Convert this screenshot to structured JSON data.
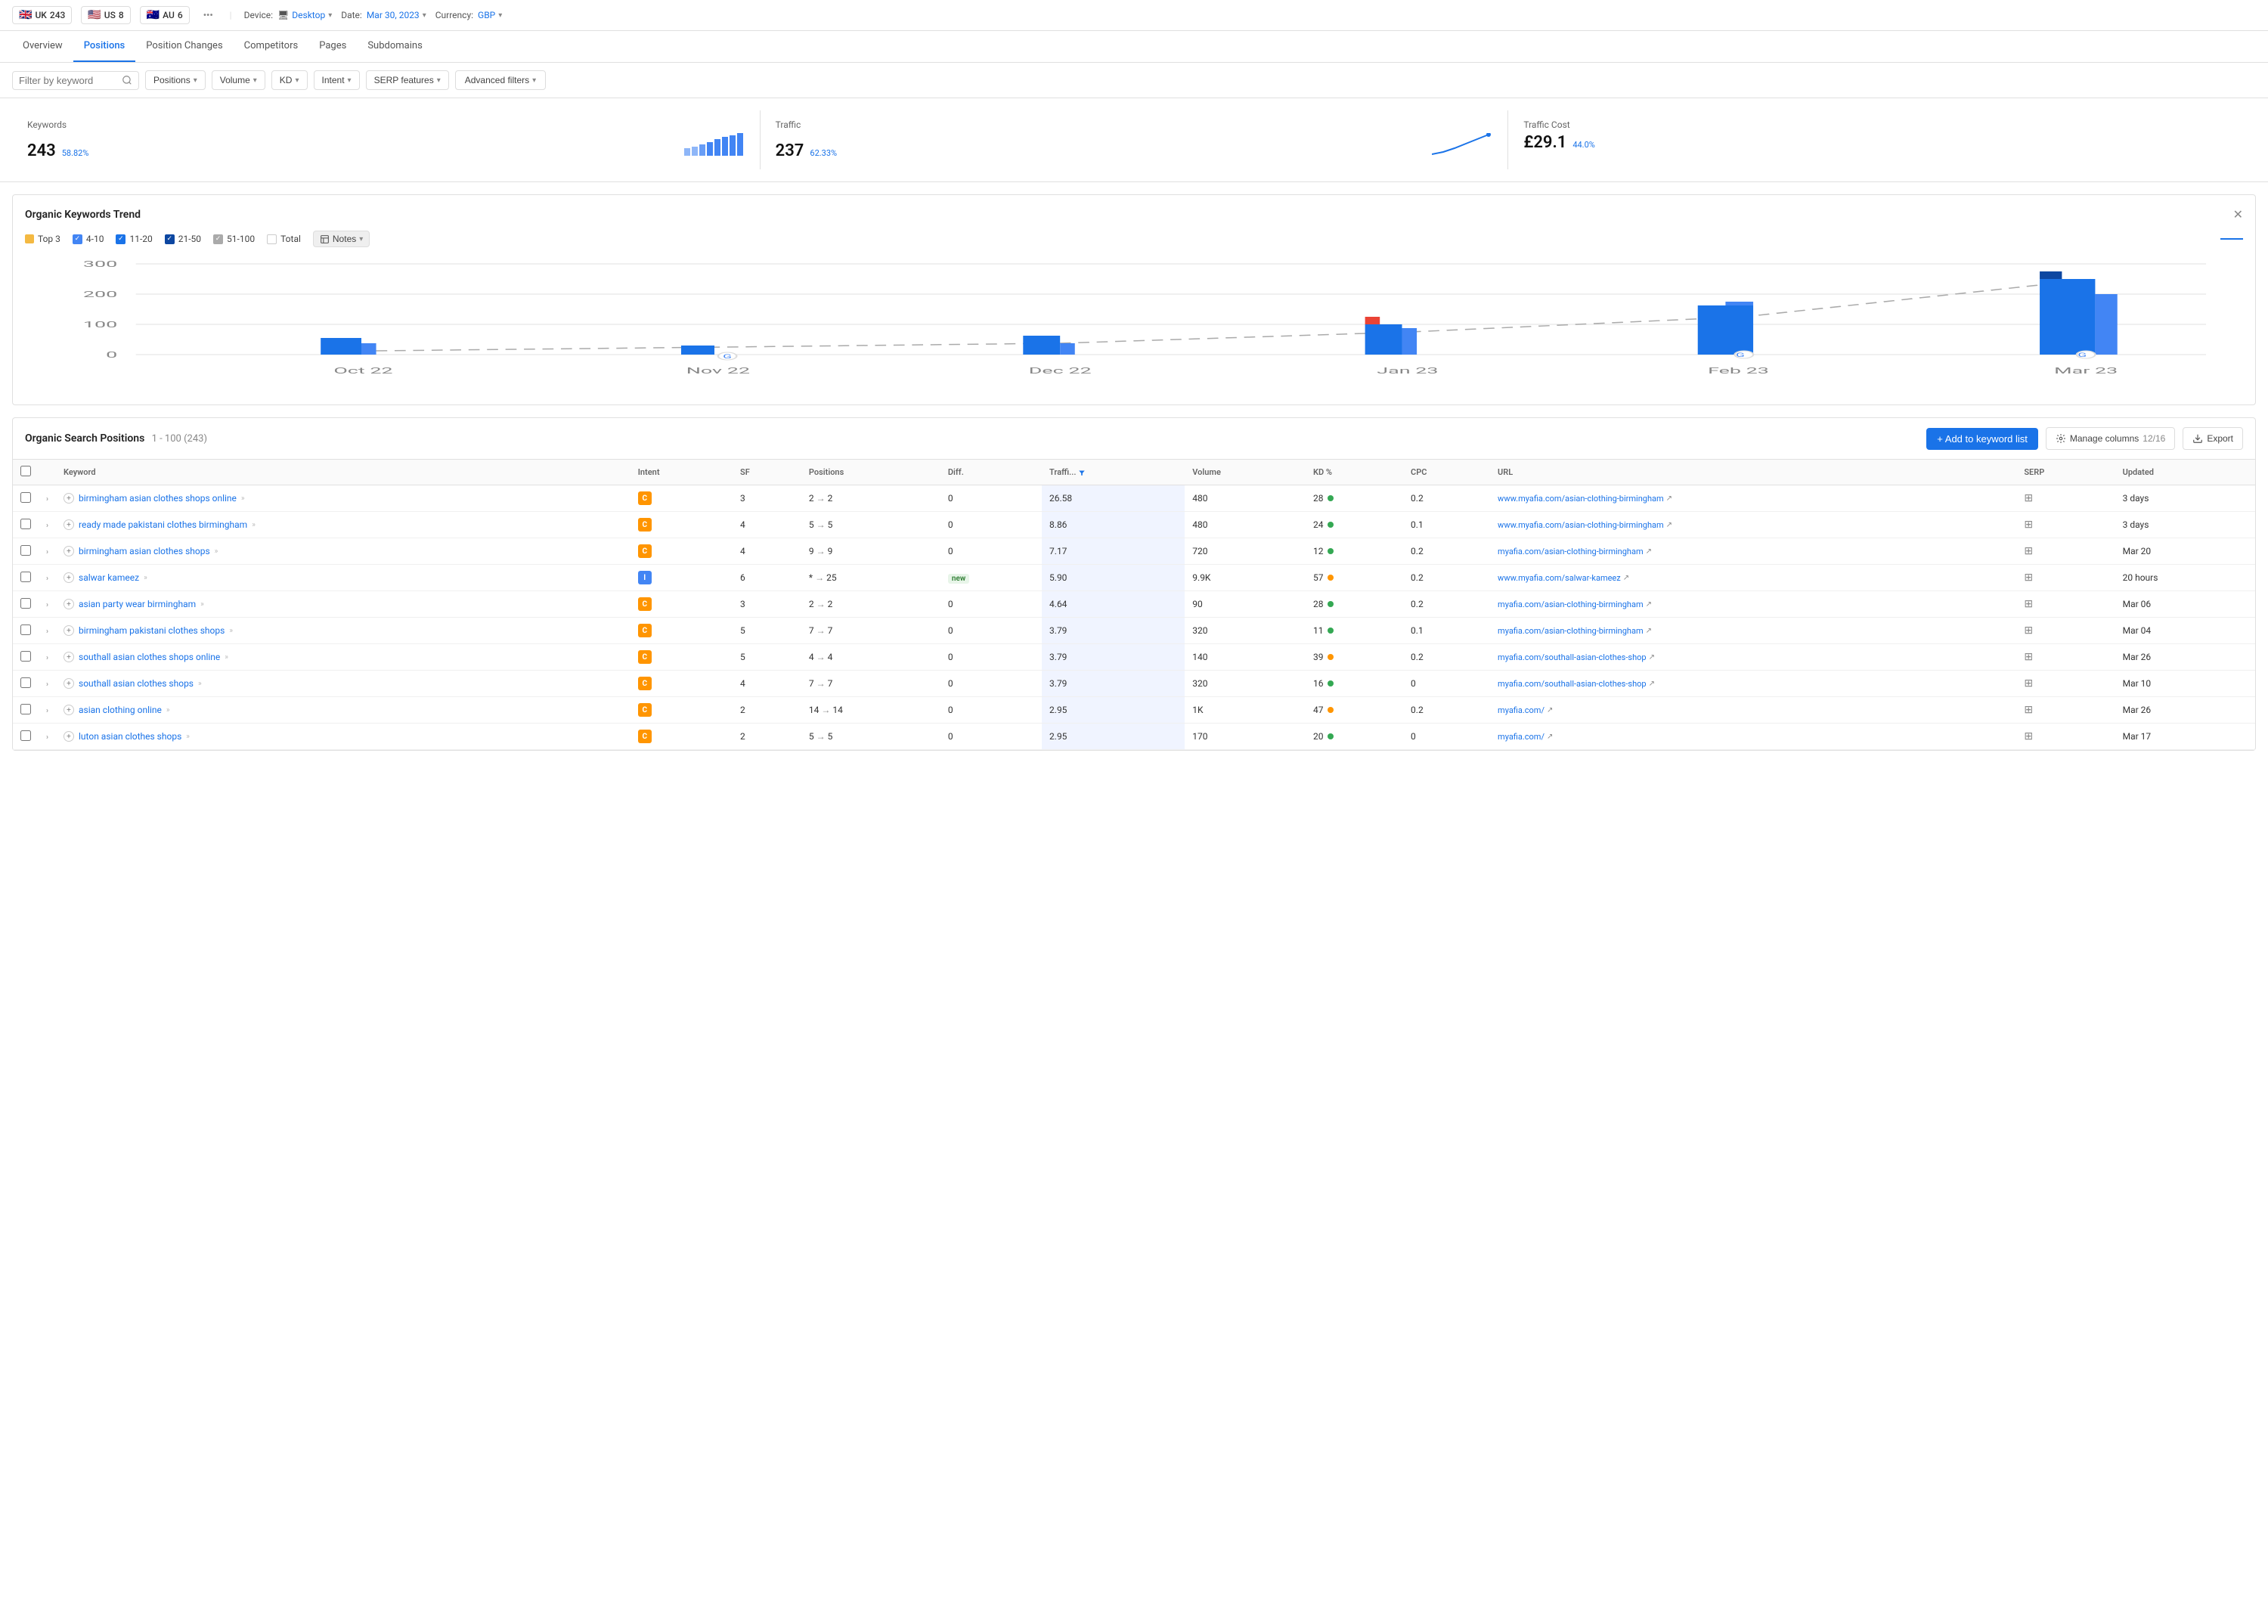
{
  "topbar": {
    "countries": [
      {
        "flag": "🇬🇧",
        "label": "UK",
        "count": "243"
      },
      {
        "flag": "🇺🇸",
        "label": "US",
        "count": "8"
      },
      {
        "flag": "🇦🇺",
        "label": "AU",
        "count": "6"
      }
    ],
    "device_label": "Device:",
    "device_value": "Desktop",
    "date_label": "Date:",
    "date_value": "Mar 30, 2023",
    "currency_label": "Currency:",
    "currency_value": "GBP"
  },
  "nav": {
    "tabs": [
      "Overview",
      "Positions",
      "Position Changes",
      "Competitors",
      "Pages",
      "Subdomains"
    ],
    "active": "Positions"
  },
  "filters": {
    "keyword_placeholder": "Filter by keyword",
    "positions_label": "Positions",
    "volume_label": "Volume",
    "kd_label": "KD",
    "intent_label": "Intent",
    "serp_label": "SERP features",
    "advanced_label": "Advanced filters"
  },
  "stats": {
    "keywords": {
      "label": "Keywords",
      "value": "243",
      "change": "58.82%"
    },
    "traffic": {
      "label": "Traffic",
      "value": "237",
      "change": "62.33%"
    },
    "traffic_cost": {
      "label": "Traffic Cost",
      "value": "£29.1",
      "change": "44.0%"
    }
  },
  "trend": {
    "title": "Organic Keywords Trend",
    "legend": [
      {
        "label": "Top 3",
        "color": "#f4b942",
        "checked": true
      },
      {
        "label": "4-10",
        "color": "#4285f4",
        "checked": true
      },
      {
        "label": "11-20",
        "color": "#1a73e8",
        "checked": true
      },
      {
        "label": "21-50",
        "color": "#0d47a1",
        "checked": true
      },
      {
        "label": "51-100",
        "color": "#e0e0e0",
        "checked": true
      },
      {
        "label": "Total",
        "color": "#e0e0e0",
        "checked": false
      }
    ],
    "notes_label": "Notes",
    "x_labels": [
      "Oct 22",
      "Nov 22",
      "Dec 22",
      "Jan 23",
      "Feb 23",
      "Mar 23"
    ],
    "y_labels": [
      "300",
      "200",
      "100",
      "0"
    ]
  },
  "positions": {
    "title": "Organic Search Positions",
    "range": "1 - 100",
    "total": "243",
    "add_keyword_label": "+ Add to keyword list",
    "manage_cols_label": "Manage columns",
    "manage_cols_count": "12/16",
    "export_label": "Export",
    "columns": [
      "Keyword",
      "Intent",
      "SF",
      "Positions",
      "Diff.",
      "Traffic",
      "Volume",
      "KD %",
      "CPC",
      "URL",
      "SERP",
      "Updated"
    ],
    "rows": [
      {
        "keyword": "birmingham asian clothes shops online",
        "chevrons": "»",
        "intent": "C",
        "intent_type": "c",
        "sf": "3",
        "pos_from": "2",
        "pos_to": "2",
        "diff": "0",
        "traffic": "26.58",
        "volume": "480",
        "kd": "28",
        "kd_color": "green",
        "cpc": "0.2",
        "url": "www.myafia.com/asian-clothing-birmingham",
        "url_display": "www.myafia.com/asian-clothing-birmingham",
        "serp": "↗",
        "updated": "3 days"
      },
      {
        "keyword": "ready made pakistani clothes birmingham",
        "chevrons": "»",
        "intent": "C",
        "intent_type": "c",
        "sf": "4",
        "pos_from": "5",
        "pos_to": "5",
        "diff": "0",
        "traffic": "8.86",
        "volume": "480",
        "kd": "24",
        "kd_color": "green",
        "cpc": "0.1",
        "url": "www.myafia.com/asian-clothing-birmingham",
        "url_display": "www.myafia.com/asian-clothing-birmingham",
        "serp": "↗",
        "updated": "3 days"
      },
      {
        "keyword": "birmingham asian clothes shops",
        "chevrons": "»",
        "intent": "C",
        "intent_type": "c",
        "sf": "4",
        "pos_from": "9",
        "pos_to": "9",
        "diff": "0",
        "traffic": "7.17",
        "volume": "720",
        "kd": "12",
        "kd_color": "green",
        "cpc": "0.2",
        "url": "myafia.com/asian-clothing-birmingham",
        "url_display": "myafia.com/asian-clothing-birmingham",
        "serp": "↗",
        "updated": "Mar 20"
      },
      {
        "keyword": "salwar kameez",
        "chevrons": "»",
        "intent": "I",
        "intent_type": "i",
        "sf": "6",
        "pos_from": "*",
        "pos_to": "25",
        "diff": "new",
        "traffic": "5.90",
        "volume": "9.9K",
        "kd": "57",
        "kd_color": "orange",
        "cpc": "0.2",
        "url": "www.myafia.com/salwar-kameez",
        "url_display": "www.myafia.com/salwar-kameez",
        "serp": "↗",
        "updated": "20 hours"
      },
      {
        "keyword": "asian party wear birmingham",
        "chevrons": "»",
        "intent": "C",
        "intent_type": "c",
        "sf": "3",
        "pos_from": "2",
        "pos_to": "2",
        "diff": "0",
        "traffic": "4.64",
        "volume": "90",
        "kd": "28",
        "kd_color": "green",
        "cpc": "0.2",
        "url": "myafia.com/asian-clothing-birmingham",
        "url_display": "myafia.com/asian-clothing-birmingham",
        "serp": "↗",
        "updated": "Mar 06"
      },
      {
        "keyword": "birmingham pakistani clothes shops",
        "chevrons": "»",
        "intent": "C",
        "intent_type": "c",
        "sf": "5",
        "pos_from": "7",
        "pos_to": "7",
        "diff": "0",
        "traffic": "3.79",
        "volume": "320",
        "kd": "11",
        "kd_color": "green",
        "cpc": "0.1",
        "url": "myafia.com/asian-clothing-birmingham",
        "url_display": "myafia.com/asian-clothing-birmingham",
        "serp": "↗",
        "updated": "Mar 04"
      },
      {
        "keyword": "southall asian clothes shops online",
        "chevrons": "»",
        "intent": "C",
        "intent_type": "c",
        "sf": "5",
        "pos_from": "4",
        "pos_to": "4",
        "diff": "0",
        "traffic": "3.79",
        "volume": "140",
        "kd": "39",
        "kd_color": "orange",
        "cpc": "0.2",
        "url": "myafia.com/southall-asian-clothes-shop",
        "url_display": "myafia.com/southall-asian-clothes-shop",
        "serp": "↗",
        "updated": "Mar 26"
      },
      {
        "keyword": "southall asian clothes shops",
        "chevrons": "»",
        "intent": "C",
        "intent_type": "c",
        "sf": "4",
        "pos_from": "7",
        "pos_to": "7",
        "diff": "0",
        "traffic": "3.79",
        "volume": "320",
        "kd": "16",
        "kd_color": "green",
        "cpc": "0",
        "url": "myafia.com/southall-asian-clothes-shop",
        "url_display": "myafia.com/southall-asian-clothes-shop",
        "serp": "↗",
        "updated": "Mar 10"
      },
      {
        "keyword": "asian clothing online",
        "chevrons": "»",
        "intent": "C",
        "intent_type": "c",
        "sf": "2",
        "pos_from": "14",
        "pos_to": "14",
        "diff": "0",
        "traffic": "2.95",
        "volume": "1K",
        "kd": "47",
        "kd_color": "orange",
        "cpc": "0.2",
        "url": "myafia.com/",
        "url_display": "myafia.com/",
        "serp": "↗",
        "updated": "Mar 26"
      },
      {
        "keyword": "luton asian clothes shops",
        "chevrons": "»",
        "intent": "C",
        "intent_type": "c",
        "sf": "2",
        "pos_from": "5",
        "pos_to": "5",
        "diff": "0",
        "traffic": "2.95",
        "volume": "170",
        "kd": "20",
        "kd_color": "green",
        "cpc": "0",
        "url": "myafia.com/",
        "url_display": "myafia.com/",
        "serp": "↗",
        "updated": "Mar 17"
      }
    ]
  }
}
